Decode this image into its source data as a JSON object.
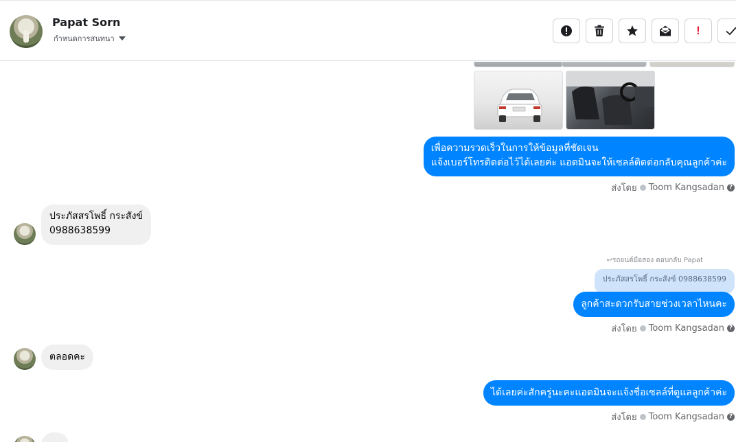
{
  "header": {
    "contact_name": "Papat Sorn",
    "subtitle": "กำหนดการสนทนา",
    "toolbar": [
      {
        "name": "spam-button",
        "icon": "alert-circle-icon"
      },
      {
        "name": "delete-button",
        "icon": "trash-icon"
      },
      {
        "name": "star-button",
        "icon": "star-icon"
      },
      {
        "name": "mark-unread-button",
        "icon": "envelope-icon"
      },
      {
        "name": "follow-up-button",
        "icon": "exclamation-icon",
        "label": "!"
      },
      {
        "name": "done-button",
        "icon": "check-icon"
      }
    ]
  },
  "messages": {
    "out1": {
      "line1": "เพื่อความรวดเร็วในการให้ข้อมูลที่ชัดเจน",
      "line2": "แจ้งเบอร์โทรติดต่อไว้ได้เลยค่ะ แอดมินจะให้เซลล์ติดต่อกลับคุณลูกค้าค่ะ",
      "sent_by_label": "ส่งโดย",
      "sender": "Toom Kangsadan"
    },
    "in1": {
      "line1": "ประภัสสรโพธิ์ กระสังข์",
      "line2": "0988638599"
    },
    "out2": {
      "reply_label": "รถยนต์มือสอง ตอบกลับ Papat",
      "quote": "ประภัสสรโพธิ์ กระสังข์ 0988638599",
      "text": "ลูกค้าสะดวกรับสายช่วงเวลาไหนคะ",
      "sent_by_label": "ส่งโดย",
      "sender": "Toom Kangsadan"
    },
    "in2": {
      "text": "ตลอดคะ"
    },
    "out3": {
      "text": "ได้เลยค่ะสักครู่นะคะแอดมินจะแจ้งชื่อเซลล์ที่ดูแลลูกค้าค่ะ",
      "sent_by_label": "ส่งโดย",
      "sender": "Toom Kangsadan"
    }
  },
  "colors": {
    "outgoing_bubble": "#0084ff",
    "incoming_bubble": "#f0f0f0",
    "reply_quote": "#cfe4fb",
    "follow_up": "#e41e3f"
  }
}
